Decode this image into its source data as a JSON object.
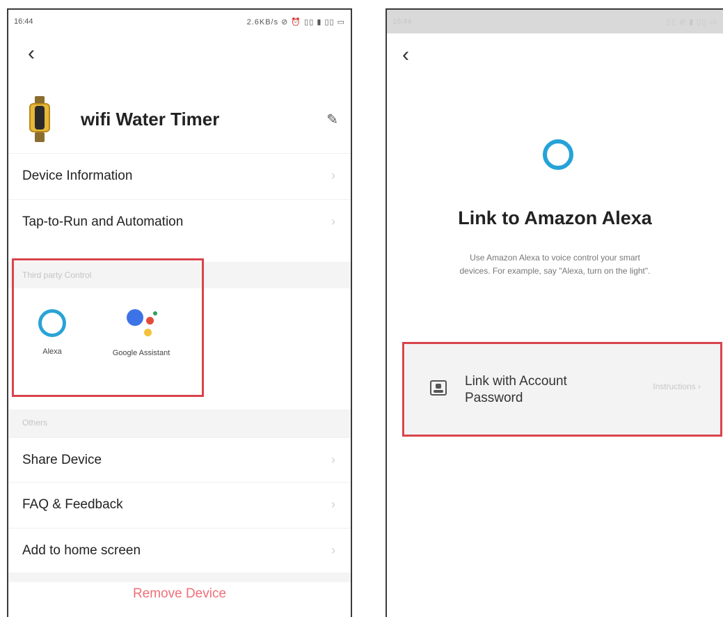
{
  "left": {
    "status": {
      "time": "16:44",
      "icons": "2.6KB/s ⊘ ⏰ ▯▯ ▮ ▯▯ ▭"
    },
    "back_glyph": "‹",
    "device": {
      "name": "wifi Water Timer",
      "edit_glyph": "✎"
    },
    "rows_top": [
      "Device Information",
      "Tap-to-Run and Automation"
    ],
    "third_party": {
      "label": "Third party Control",
      "items": [
        {
          "label": "Alexa",
          "icon": "alexa-icon"
        },
        {
          "label": "Google Assistant",
          "icon": "google-assistant-icon"
        }
      ]
    },
    "others_label": "Others",
    "rows_bottom": [
      "Share Device",
      "FAQ & Feedback",
      "Add to home screen"
    ],
    "chevron": "›",
    "remove_label": "Remove Device",
    "colors": {
      "accent_red": "#d9434b",
      "remove_text": "#ef6f78",
      "alexa_blue": "#2aa3d6"
    }
  },
  "right": {
    "status": {
      "time": "16:44",
      "icons": "▯▯ ⊘ ▮ ▯▯ ▭"
    },
    "back_glyph": "‹",
    "title": "Link to Amazon Alexa",
    "description_line1": "Use Amazon Alexa to voice control your smart",
    "description_line2": "devices. For example, say \"Alexa, turn on the light\".",
    "link_option": {
      "line1": "Link with Account",
      "line2": "Password",
      "instructions": "Instructions ›",
      "icon": "account-card-icon"
    }
  }
}
